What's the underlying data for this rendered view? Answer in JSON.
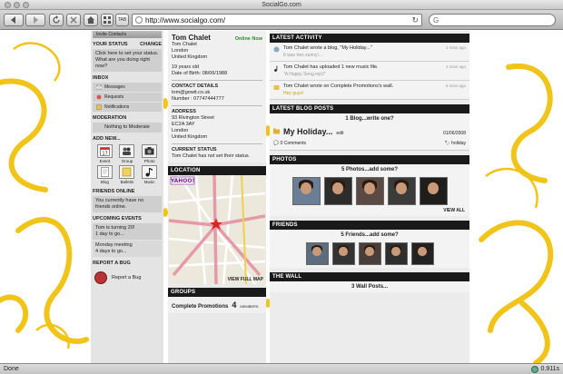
{
  "browser": {
    "title": "SocialGo.com",
    "url": "http://www.socialgo.com/",
    "tab_label": "TAB",
    "search_placeholder": "",
    "status_left": "Done",
    "status_right": "0.911s"
  },
  "left": {
    "invite_label": "Invite Contacts",
    "your_status_label": "YOUR STATUS",
    "change_label": "CHANGE",
    "status_prompt": "Click here to set your status. What are you doing right now?",
    "inbox_label": "INBOX",
    "inbox_items": [
      "Messages",
      "Requests",
      "Notifications"
    ],
    "moderation_label": "MODERATION",
    "moderation_text": "Nothing to Moderate",
    "add_new_label": "ADD NEW...",
    "add_items": [
      "Event",
      "Group",
      "Photo",
      "Blog",
      "Bulletin",
      "Music"
    ],
    "friends_online_label": "FRIENDS ONLINE",
    "friends_online_text": "You currently have no friends online.",
    "upcoming_label": "UPCOMING EVENTS",
    "events": [
      {
        "title": "Tom is turning 20!",
        "when": "1 day to go..."
      },
      {
        "title": "Monday meeting",
        "when": "4 days to go..."
      }
    ],
    "report_label": "REPORT A BUG",
    "report_text": "Report a Bug"
  },
  "profile": {
    "name": "Tom Chalet",
    "online": "Online Now",
    "lines": [
      "Tom Chalet",
      "London",
      "United Kingdom"
    ],
    "age": "19 years old",
    "dob": "Date of Birth: 08/06/1988",
    "contact_label": "CONTACT DETAILS",
    "email": "tom@gowit.co.uk",
    "number": "Number : 07747444777",
    "address_label": "ADDRESS",
    "address": [
      "93 Rivington Street",
      "EC2A 3AY",
      "London",
      "United Kingdom"
    ],
    "current_status_label": "CURRENT STATUS",
    "current_status": "Tom Chalet has not set their status.",
    "location_label": "LOCATION",
    "map_brand": "YAHOO!",
    "view_map": "VIEW FULL MAP",
    "groups_label": "GROUPS",
    "group_name": "Complete Promotions",
    "group_count": "4",
    "group_members": "MEMBERS"
  },
  "right": {
    "activity_label": "LATEST ACTIVITY",
    "activities": [
      {
        "text": "Tom Chalet wrote a blog, \"My Holiday...\"",
        "sub": "It was tres sunny!...",
        "time": "2 mins ago"
      },
      {
        "text": "Tom Chalet has uploaded 1 new music file.",
        "sub": "\"A Happy Song.mp3\"",
        "time": "4 mins ago"
      },
      {
        "text": "Tom Chalet wrote on Complete Promotions's wall.",
        "sub": "Hey guys!",
        "time": "5 mins ago"
      }
    ],
    "blog_label": "LATEST BLOG POSTS",
    "blog_count": "1 Blog...write one?",
    "blog_title": "My Holiday...",
    "blog_edit": "edit",
    "blog_date": "01/06/2008",
    "blog_comments": "0 Comments",
    "blog_tag": "holiday",
    "photos_label": "PHOTOS",
    "photos_count": "5 Photos...add some?",
    "view_all": "VIEW ALL",
    "friends_label": "FRIENDS",
    "friends_count": "5 Friends...add some?",
    "wall_label": "THE WALL",
    "wall_count": "3 Wall Posts..."
  },
  "colors": {
    "accent_yellow": "#f0c419",
    "header_black": "#1a1a1a",
    "online_green": "#2a8a2a"
  }
}
